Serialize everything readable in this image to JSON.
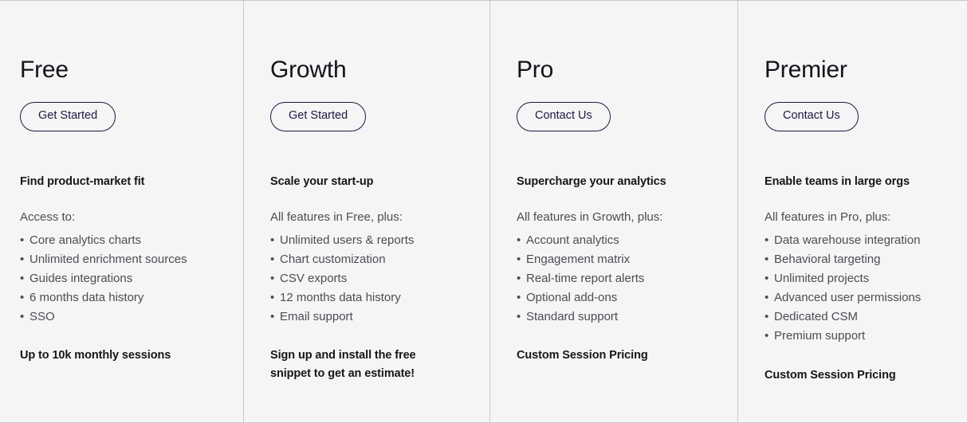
{
  "theme": {
    "background": "#f5f5f5",
    "divider": "#c5cad0",
    "heading_color": "#13131a",
    "body_color": "#4c4c55",
    "button_border": "#221745"
  },
  "plans": [
    {
      "name": "Free",
      "cta_label": "Get Started",
      "tagline": "Find product-market fit",
      "features_intro": "Access to:",
      "features": [
        "Core analytics charts",
        "Unlimited enrichment sources",
        "Guides integrations",
        "6 months data history",
        "SSO"
      ],
      "footnote": "Up to 10k monthly sessions"
    },
    {
      "name": "Growth",
      "cta_label": "Get Started",
      "tagline": "Scale your start-up",
      "features_intro": "All features in Free, plus:",
      "features": [
        "Unlimited users & reports",
        "Chart customization",
        "CSV exports",
        "12 months data history",
        "Email support"
      ],
      "footnote": "Sign up and install the free snippet to get an estimate!"
    },
    {
      "name": "Pro",
      "cta_label": "Contact Us",
      "tagline": "Supercharge your analytics",
      "features_intro": "All features in Growth, plus:",
      "features": [
        "Account analytics",
        "Engagement matrix",
        "Real-time report alerts",
        "Optional add-ons",
        "Standard support"
      ],
      "footnote": "Custom Session Pricing"
    },
    {
      "name": "Premier",
      "cta_label": "Contact Us",
      "tagline": "Enable teams in large orgs",
      "features_intro": "All features in Pro, plus:",
      "features": [
        "Data warehouse integration",
        "Behavioral targeting",
        "Unlimited projects",
        "Advanced user permissions",
        "Dedicated CSM",
        "Premium support"
      ],
      "footnote": "Custom Session Pricing"
    }
  ]
}
